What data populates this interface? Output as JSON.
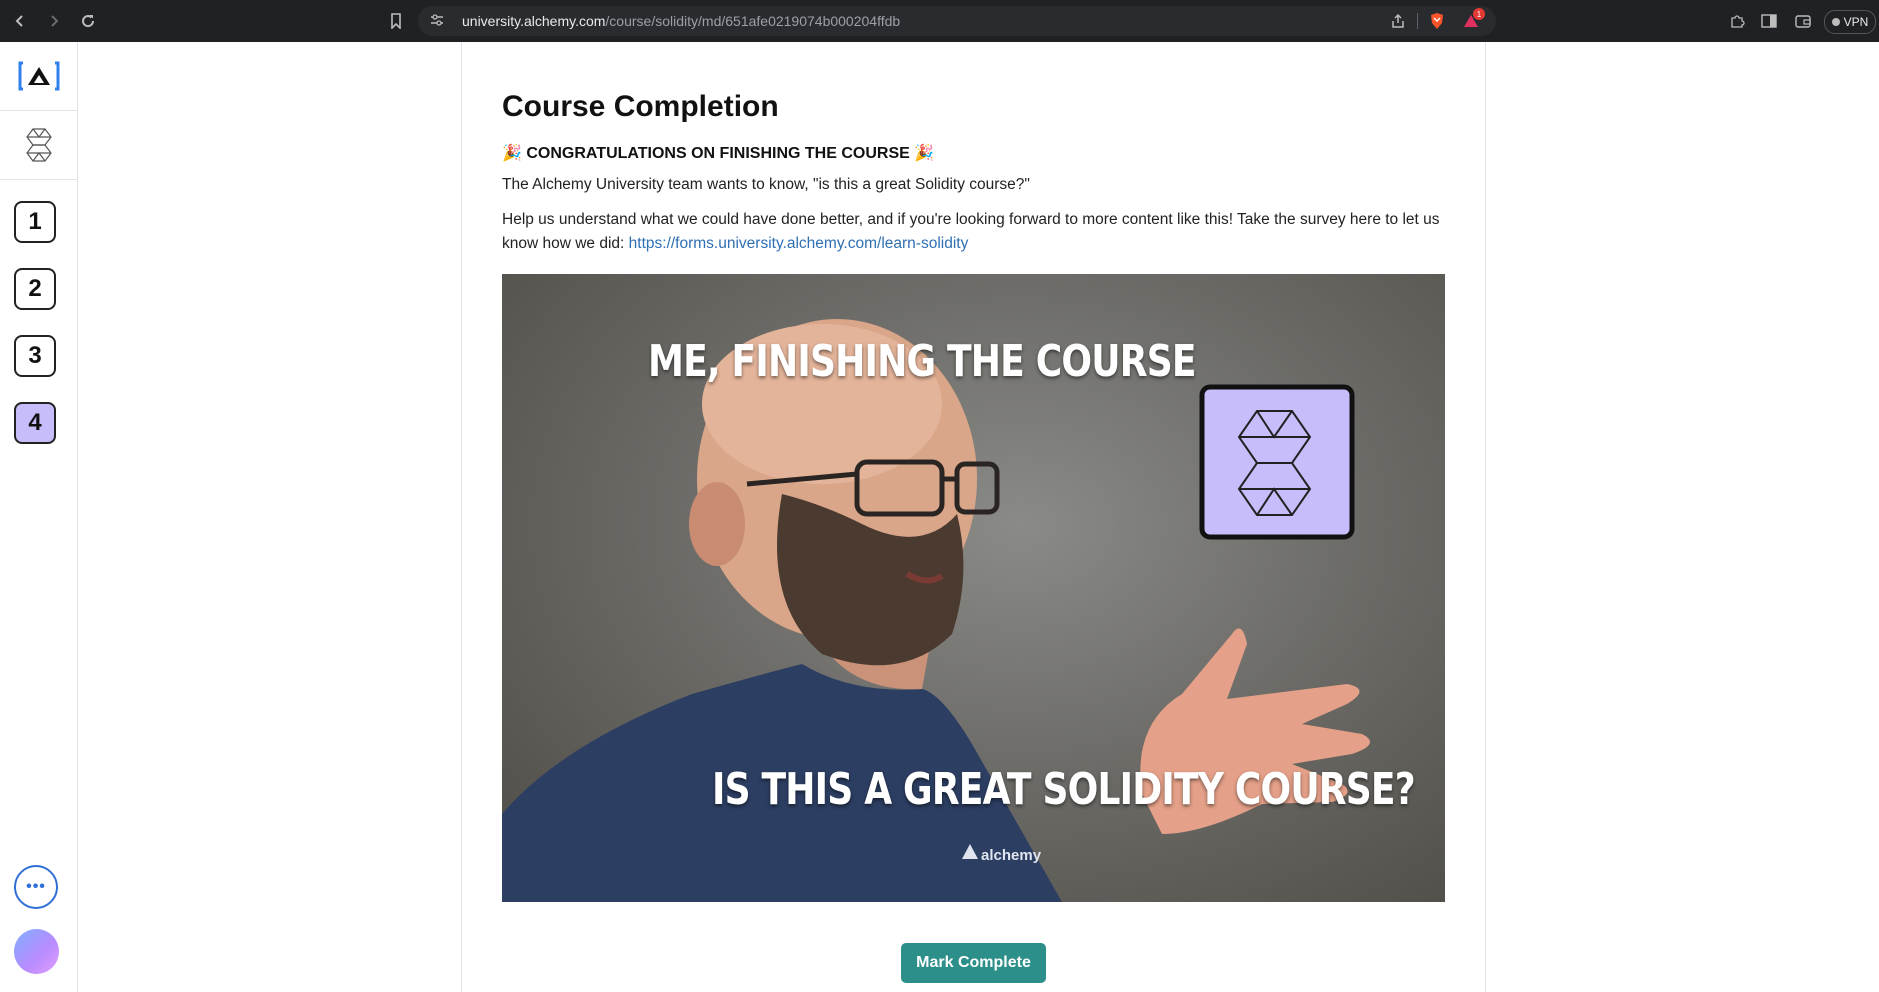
{
  "browser": {
    "url_host": "university.alchemy.com",
    "url_path": "/course/solidity/md/651afe0219074b000204ffdb",
    "vpn_label": "VPN",
    "brave_badge_count": "1"
  },
  "sidebar": {
    "steps": [
      {
        "label": "1",
        "active": false
      },
      {
        "label": "2",
        "active": false
      },
      {
        "label": "3",
        "active": false
      },
      {
        "label": "4",
        "active": true
      }
    ],
    "more_label": "•••"
  },
  "main": {
    "title": "Course Completion",
    "congrats_emoji": "🎉",
    "congrats_text": "CONGRATULATIONS ON FINISHING THE COURSE",
    "para1": "The Alchemy University team wants to know, \"is this a great Solidity course?\"",
    "para2": "Help us understand what we could have done better, and if you're looking forward to more content like this! Take the survey here to let us know how we did:",
    "survey_link": "https://forms.university.alchemy.com/learn-solidity",
    "image": {
      "caption_top": "ME, FINISHING THE COURSE",
      "caption_bottom": "IS THIS A GREAT SOLIDITY COURSE?",
      "shirt_text": "alchemy"
    },
    "mark_complete_label": "Mark Complete"
  },
  "colors": {
    "accent_purple": "#c8bdfb",
    "button_teal": "#2c8f8a",
    "link_blue": "#2f6fb3"
  }
}
